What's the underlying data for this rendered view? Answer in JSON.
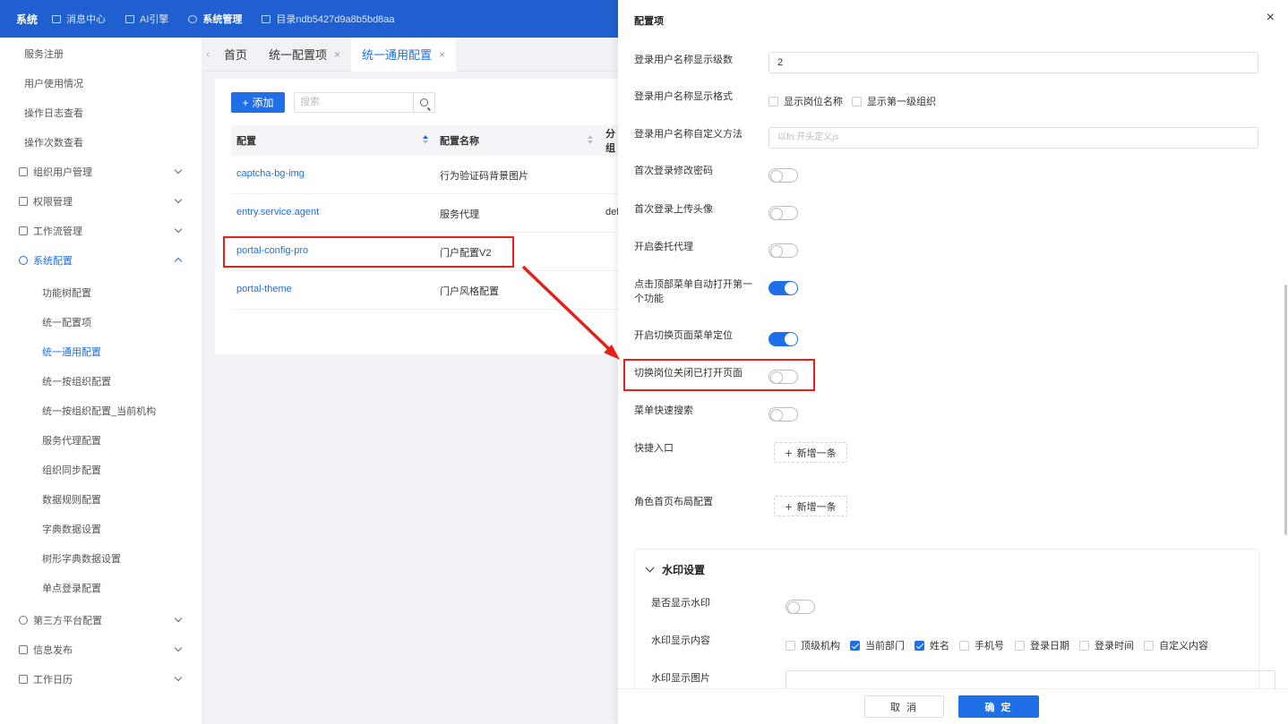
{
  "topbar": {
    "brand": "系统",
    "nav": [
      {
        "label": "消息中心",
        "icon": "message-icon"
      },
      {
        "label": "AI引擎",
        "icon": "ai-engine-icon"
      },
      {
        "label": "系统管理",
        "icon": "gear-icon",
        "active": true
      },
      {
        "label": "目录ndb5427d9a8b5bd8aa",
        "icon": "folder-icon"
      }
    ]
  },
  "sidebar": {
    "items": [
      {
        "label": "服务注册"
      },
      {
        "label": "用户使用情况"
      },
      {
        "label": "操作日志查看"
      },
      {
        "label": "操作次数查看"
      },
      {
        "label": "组织用户管理"
      },
      {
        "label": "权限管理"
      },
      {
        "label": "工作流管理"
      },
      {
        "label": "系统配置"
      },
      {
        "label": "功能树配置"
      },
      {
        "label": "统一配置项"
      },
      {
        "label": "统一通用配置"
      },
      {
        "label": "统一按组织配置"
      },
      {
        "label": "统一按组织配置_当前机构"
      },
      {
        "label": "服务代理配置"
      },
      {
        "label": "组织同步配置"
      },
      {
        "label": "数据规则配置"
      },
      {
        "label": "字典数据设置"
      },
      {
        "label": "树形字典数据设置"
      },
      {
        "label": "单点登录配置"
      },
      {
        "label": "第三方平台配置"
      },
      {
        "label": "信息发布"
      },
      {
        "label": "工作日历"
      }
    ]
  },
  "tabs": [
    {
      "label": "首页"
    },
    {
      "label": "统一配置项",
      "close": "×"
    },
    {
      "label": "统一通用配置",
      "close": "×"
    }
  ],
  "toolbar": {
    "add_label": "添加",
    "add_plus": "+",
    "search_placeholder": "搜索"
  },
  "table": {
    "headers": [
      "配置",
      "配置名称",
      "分组"
    ],
    "rows": [
      {
        "key": "captcha-bg-img",
        "name": "行为验证码背景图片",
        "group": ""
      },
      {
        "key": "entry.service.agent",
        "name": "服务代理",
        "group": "default"
      },
      {
        "key": "portal-config-pro",
        "name": "门户配置V2",
        "group": ""
      },
      {
        "key": "portal-theme",
        "name": "门户风格配置",
        "group": ""
      }
    ]
  },
  "drawer": {
    "title": "配置项",
    "close": "×",
    "fields": {
      "name_levels": {
        "label": "登录用户名称显示级数",
        "value": "2"
      },
      "name_format": {
        "label": "登录用户名称显示格式",
        "options": [
          "显示岗位名称",
          "显示第一级组织"
        ]
      },
      "name_custom": {
        "label": "登录用户名称自定义方法",
        "placeholder": "以fn:开头定义js"
      },
      "first_login_pwd": {
        "label": "首次登录修改密码",
        "on": false
      },
      "first_login_avatar": {
        "label": "首次登录上传头像",
        "on": false
      },
      "delegation": {
        "label": "开启委托代理",
        "on": false
      },
      "auto_open_first": {
        "label": "点击顶部菜单自动打开第一个功能",
        "on": true
      },
      "menu_locate": {
        "label": "开启切换页面菜单定位",
        "on": true
      },
      "close_on_switch": {
        "label": "切换岗位关闭已打开页面",
        "on": false
      },
      "menu_search": {
        "label": "菜单快速搜索",
        "on": false
      },
      "shortcuts": {
        "label": "快捷入口",
        "button": "新增一条"
      },
      "role_layout": {
        "label": "角色首页布局配置",
        "button": "新增一条"
      }
    },
    "watermark": {
      "title": "水印设置",
      "show_label": "是否显示水印",
      "content_label": "水印显示内容",
      "image_label": "水印显示图片",
      "content_options": [
        {
          "label": "顶级机构",
          "checked": false
        },
        {
          "label": "当前部门",
          "checked": true
        },
        {
          "label": "姓名",
          "checked": true
        },
        {
          "label": "手机号",
          "checked": false
        },
        {
          "label": "登录日期",
          "checked": false
        },
        {
          "label": "登录时间",
          "checked": false
        },
        {
          "label": "自定义内容",
          "checked": false
        }
      ]
    },
    "footer": {
      "cancel": "取 消",
      "ok": "确 定"
    }
  },
  "colors": {
    "primary": "#1f6fe8",
    "topbar": "#1f5fd0",
    "annotation": "#e5211b"
  }
}
